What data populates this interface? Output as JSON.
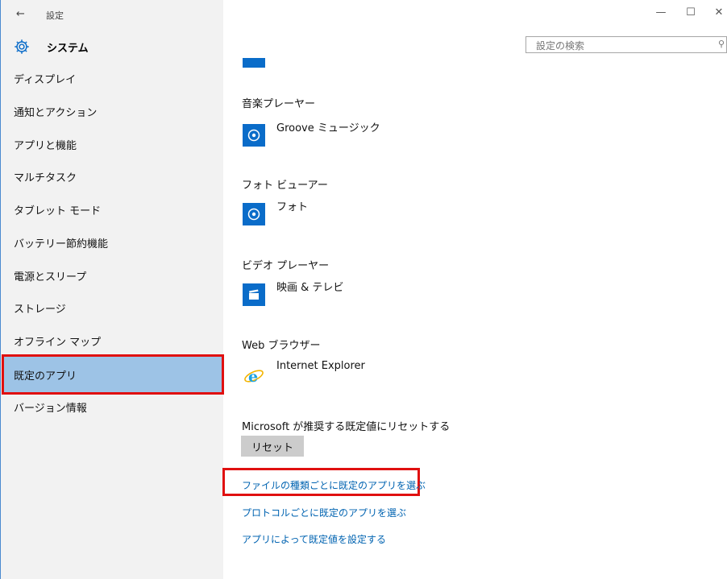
{
  "window": {
    "back_glyph": "←",
    "title": "設定",
    "minimize_glyph": "—",
    "maximize_glyph": "☐",
    "close_glyph": "✕"
  },
  "section": {
    "title": "システム",
    "icon": "gear-icon"
  },
  "search": {
    "placeholder": "設定の検索",
    "icon": "search-icon"
  },
  "nav": {
    "items": [
      {
        "label": "ディスプレイ"
      },
      {
        "label": "通知とアクション"
      },
      {
        "label": "アプリと機能"
      },
      {
        "label": "マルチタスク"
      },
      {
        "label": "タブレット モード"
      },
      {
        "label": "バッテリー節約機能"
      },
      {
        "label": "電源とスリープ"
      },
      {
        "label": "ストレージ"
      },
      {
        "label": "オフライン マップ"
      },
      {
        "label": "既定のアプリ",
        "selected": true
      },
      {
        "label": "バージョン情報"
      }
    ]
  },
  "defaults": [
    {
      "heading": "音楽プレーヤー",
      "app": "Groove ミュージック",
      "icon": "groove-music-icon"
    },
    {
      "heading": "フォト ビューアー",
      "app": "フォト",
      "icon": "photos-icon"
    },
    {
      "heading": "ビデオ プレーヤー",
      "app": "映画 & テレビ",
      "icon": "movies-tv-icon"
    },
    {
      "heading": "Web ブラウザー",
      "app": "Internet Explorer",
      "icon": "internet-explorer-icon"
    }
  ],
  "reset": {
    "description": "Microsoft が推奨する既定値にリセットする",
    "button": "リセット"
  },
  "links": {
    "by_file_type": "ファイルの種類ごとに既定のアプリを選ぶ",
    "by_protocol": "プロトコルごとに既定のアプリを選ぶ",
    "by_app": "アプリによって既定値を設定する"
  },
  "colors": {
    "accent": "#0a6cc9",
    "selected_nav": "#9dc3e6",
    "highlight": "#e01010",
    "link": "#0063b1",
    "pane": "#f2f2f2"
  }
}
